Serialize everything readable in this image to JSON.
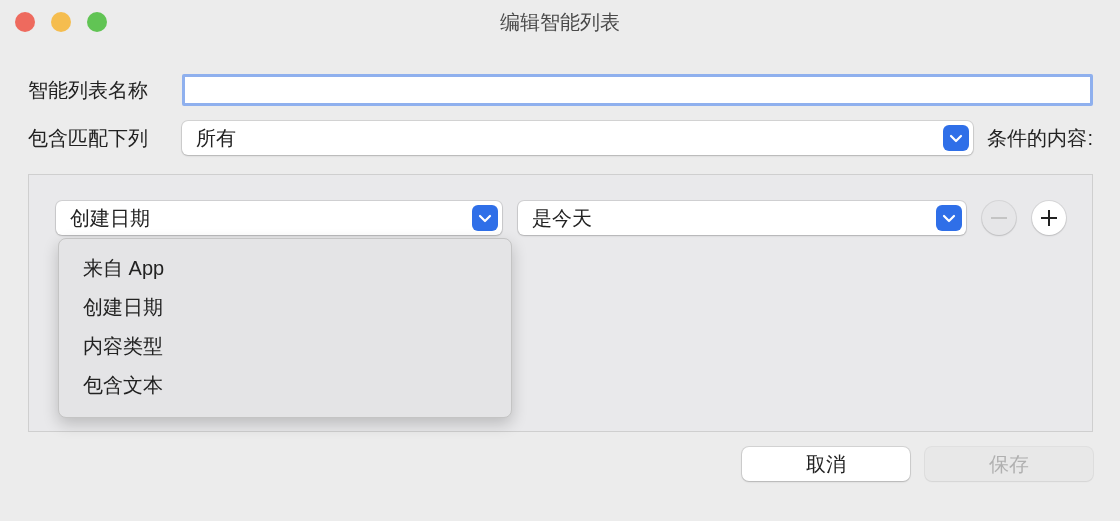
{
  "window": {
    "title": "编辑智能列表"
  },
  "name_field": {
    "label": "智能列表名称",
    "focused": true
  },
  "match": {
    "label": "包含匹配下列",
    "value": "所有",
    "suffix": "条件的内容:"
  },
  "rules": [
    {
      "field": "创建日期",
      "operator": "是今天",
      "expanded": true,
      "remove_disabled": true,
      "menu": [
        {
          "label": "来自 App"
        },
        {
          "label": "创建日期"
        },
        {
          "label": "内容类型"
        },
        {
          "label": "包含文本"
        }
      ]
    }
  ],
  "buttons": [
    {
      "label": "取消",
      "disabled": false
    },
    {
      "label": "保存",
      "disabled": true
    }
  ]
}
